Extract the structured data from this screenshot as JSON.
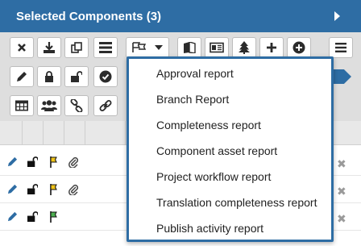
{
  "header": {
    "title": "Selected Components (3)"
  },
  "toolbar": {
    "row1": [
      "close-icon",
      "download-icon",
      "copy-icon",
      "list-icon",
      "report-flags-icon",
      "book-icon",
      "id-card-icon",
      "tree-icon",
      "plus-icon",
      "plus-circle-icon",
      "menu-icon"
    ],
    "row2": [
      "pencil-icon",
      "lock-icon",
      "unlock-icon",
      "check-circle-icon"
    ],
    "row3": [
      "table-icon",
      "users-icon",
      "link-icon",
      "unlink-icon"
    ]
  },
  "reports_menu": {
    "items": [
      "Approval report",
      "Branch Report",
      "Completeness report",
      "Component asset report",
      "Project workflow report",
      "Translation completeness report",
      "Publish activity report"
    ]
  },
  "colors": {
    "header": "#2e6da4",
    "toolbar": "#dedede",
    "dropdown_border": "#2e6da4",
    "flag_yellow": "#f0c419",
    "flag_green": "#4caf50"
  }
}
